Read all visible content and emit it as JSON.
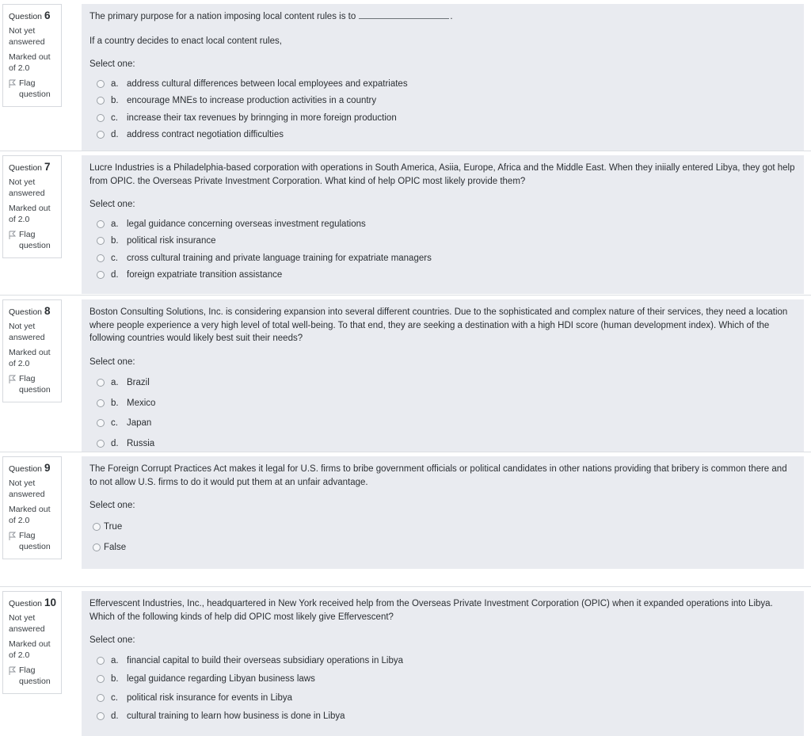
{
  "labels": {
    "question_word": "Question",
    "not_answered": "Not yet\nanswered",
    "marked_out_of": "Marked out of",
    "flag_question": "Flag\nquestion",
    "select_one": "Select one:"
  },
  "colors": {
    "page_background": "#ffffff",
    "content_panel": "#e9ebf0",
    "info_border": "#d6d9de",
    "separator": "#dcdfe3",
    "text": "#2b2f33",
    "radio_border": "#9aa0a6"
  },
  "questions": [
    {
      "number": "6",
      "state": "Not yet answered",
      "marked_out_of_label": "Marked out of",
      "marks": "2.0",
      "flag_label": "Flag question",
      "select_one": "Select one:",
      "stem_part_1_before_blank": "The primary purpose for a nation imposing local content rules is to ",
      "stem_part_1_after_blank": ".",
      "stem_part_2": "If a country decides to enact local content rules,",
      "options": [
        {
          "letter": "a.",
          "text": "address cultural differences between local employees and expatriates"
        },
        {
          "letter": "b.",
          "text": "encourage MNEs to increase production activities in a country"
        },
        {
          "letter": "c.",
          "text": "increase their tax revenues by brinnging in more foreign production"
        },
        {
          "letter": "d.",
          "text": "address contract negotiation difficulties"
        }
      ]
    },
    {
      "number": "7",
      "state": "Not yet answered",
      "marked_out_of_label": "Marked out of",
      "marks": "2.0",
      "flag_label": "Flag question",
      "select_one": "Select one:",
      "stem": "Lucre Industries is a Philadelphia-based corporation with operations in South America, Asiia, Europe, Africa and the Middle East.  When they iniially entered  Libya, they got help from OPIC. the Overseas Private Investment Corporation.   What kind of help OPIC most likely provide them?",
      "options": [
        {
          "letter": "a.",
          "text": "legal guidance concerning overseas investment regulations"
        },
        {
          "letter": "b.",
          "text": "political risk insurance"
        },
        {
          "letter": "c.",
          "text": "cross cultural training and private language training for expatriate managers"
        },
        {
          "letter": "d.",
          "text": "foreign expatriate transition assistance"
        }
      ]
    },
    {
      "number": "8",
      "state": "Not yet answered",
      "marked_out_of_label": "Marked out of",
      "marks": "2.0",
      "flag_label": "Flag question",
      "select_one": "Select one:",
      "stem": "Boston Consulting Solutions, Inc. is considering expansion into several different countries. Due to the sophisticated and complex nature of their services, they need a location where people experience a very high level of total well-being.  To that end, they are seeking a destination with a high HDI score (human development index). Which of the following countries would likely best suit their needs?",
      "options": [
        {
          "letter": "a.",
          "text": "Brazil"
        },
        {
          "letter": "b.",
          "text": "Mexico"
        },
        {
          "letter": "c.",
          "text": "Japan"
        },
        {
          "letter": "d.",
          "text": "Russia"
        }
      ]
    },
    {
      "number": "9",
      "state": "Not yet answered",
      "marked_out_of_label": "Marked out of",
      "marks": "2.0",
      "flag_label": "Flag question",
      "select_one": "Select one:",
      "stem": "The Foreign Corrupt Practices Act makes it legal for  U.S. firms to bribe government officials or political candidates in other nations providing that bribery is common there and to not allow U.S. firms to do it would put them at an unfair advantage.",
      "options": [
        {
          "letter": "",
          "text": "True"
        },
        {
          "letter": "",
          "text": "False"
        }
      ]
    },
    {
      "number": "10",
      "state": "Not yet answered",
      "marked_out_of_label": "Marked out of",
      "marks": "2.0",
      "flag_label": "Flag question",
      "select_one": "Select one:",
      "stem": "Effervescent Industries, Inc., headquartered in New York received help from the Overseas Private Investment Corporation (OPIC) when it expanded operations into Libya.  Which of the following kinds of help did OPIC most likely give Effervescent?",
      "options": [
        {
          "letter": "a.",
          "text": "financial capital to build their overseas subsidiary operations in Libya"
        },
        {
          "letter": "b.",
          "text": "legal guidance regarding Libyan business laws"
        },
        {
          "letter": "c.",
          "text": "political risk insurance for events in Libya"
        },
        {
          "letter": "d.",
          "text": "cultural training to learn how business is done in Libya"
        }
      ]
    }
  ]
}
